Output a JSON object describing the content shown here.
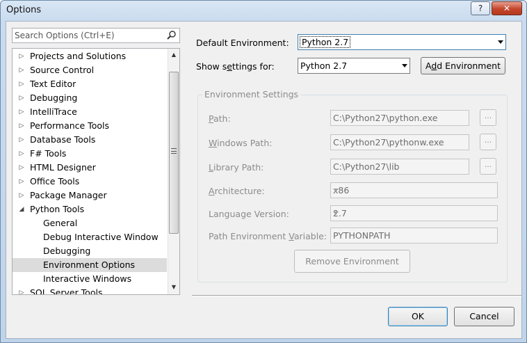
{
  "window": {
    "title": "Options",
    "help_label": "?",
    "close_label": "✕"
  },
  "search": {
    "placeholder": "Search Options (Ctrl+E)"
  },
  "tree": {
    "items": [
      {
        "label": "Projects and Solutions",
        "level": 0,
        "expander": "▷"
      },
      {
        "label": "Source Control",
        "level": 0,
        "expander": "▷"
      },
      {
        "label": "Text Editor",
        "level": 0,
        "expander": "▷"
      },
      {
        "label": "Debugging",
        "level": 0,
        "expander": "▷"
      },
      {
        "label": "IntelliTrace",
        "level": 0,
        "expander": "▷"
      },
      {
        "label": "Performance Tools",
        "level": 0,
        "expander": "▷"
      },
      {
        "label": "Database Tools",
        "level": 0,
        "expander": "▷"
      },
      {
        "label": "F# Tools",
        "level": 0,
        "expander": "▷"
      },
      {
        "label": "HTML Designer",
        "level": 0,
        "expander": "▷"
      },
      {
        "label": "Office Tools",
        "level": 0,
        "expander": "▷"
      },
      {
        "label": "Package Manager",
        "level": 0,
        "expander": "▷"
      },
      {
        "label": "Python Tools",
        "level": 0,
        "expander": "◢"
      },
      {
        "label": "General",
        "level": 1,
        "expander": ""
      },
      {
        "label": "Debug Interactive Window",
        "level": 1,
        "expander": ""
      },
      {
        "label": "Debugging",
        "level": 1,
        "expander": ""
      },
      {
        "label": "Environment Options",
        "level": 1,
        "expander": "",
        "selected": true
      },
      {
        "label": "Interactive Windows",
        "level": 1,
        "expander": ""
      },
      {
        "label": "SQL Server Tools",
        "level": 0,
        "expander": "▷"
      }
    ],
    "scroll_up": "▲",
    "scroll_down": "▼"
  },
  "settings": {
    "default_env_label": "Default Environment:",
    "default_env_value": "Python 2.7",
    "show_for_label_pre": "Show s",
    "show_for_label_ul": "e",
    "show_for_label_post": "ttings for:",
    "show_for_value": "Python 2.7",
    "add_env_pre": "A",
    "add_env_ul": "d",
    "add_env_post": "d Environment",
    "group_title": "Environment Settings",
    "path_label_ul": "P",
    "path_label_rest": "ath:",
    "path_value": "C:\\Python27\\python.exe",
    "windows_path_label_ul": "W",
    "windows_path_label_rest": "indows Path:",
    "windows_path_value": "C:\\Python27\\pythonw.exe",
    "library_path_label_ul": "L",
    "library_path_label_rest": "ibrary Path:",
    "library_path_value": "C:\\Python27\\lib",
    "browse_label": "...",
    "architecture_label_ul": "A",
    "architecture_label_rest": "rchitecture:",
    "architecture_value": "x86",
    "language_version_label": "Language Version:",
    "language_version_value": "2.7",
    "path_env_var_label_pre": "Path Environment ",
    "path_env_var_label_ul": "V",
    "path_env_var_label_post": "ariable:",
    "path_env_var_value": "PYTHONPATH",
    "remove_env_label": "Remove Environment"
  },
  "footer": {
    "ok_label": "OK",
    "cancel_label": "Cancel"
  }
}
